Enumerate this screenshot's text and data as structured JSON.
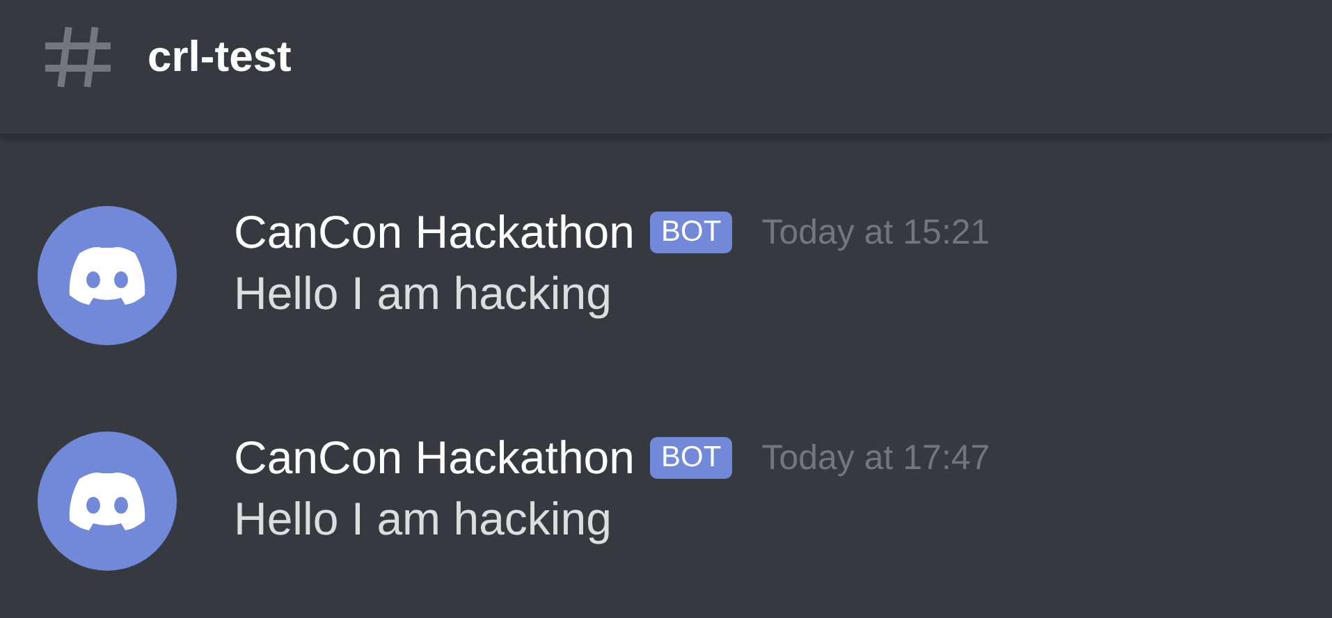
{
  "channel": {
    "name": "crl-test"
  },
  "messages": [
    {
      "author": "CanCon Hackathon",
      "badge": "BOT",
      "timestamp": "Today at 15:21",
      "text": "Hello I am hacking"
    },
    {
      "author": "CanCon Hackathon",
      "badge": "BOT",
      "timestamp": "Today at 17:47",
      "text": "Hello I am hacking"
    }
  ]
}
